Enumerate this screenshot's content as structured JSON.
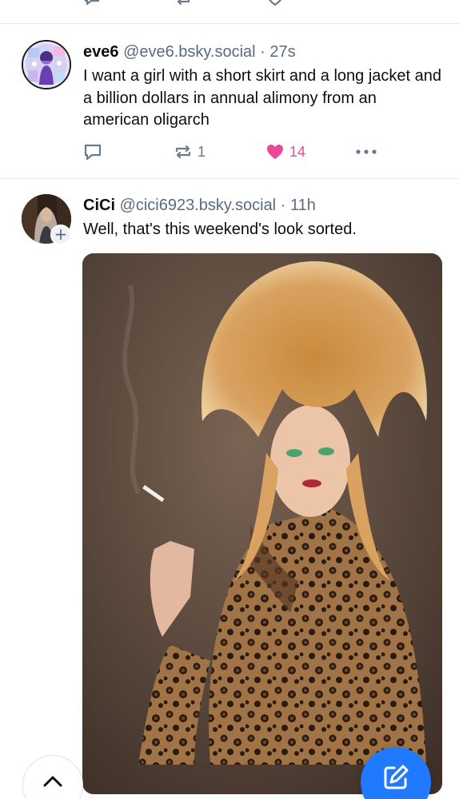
{
  "posts": [
    {
      "display_name": "eve6",
      "handle": "@eve6.bsky.social",
      "separator": "·",
      "timestamp": "27s",
      "text": "I want a girl with a short skirt and a long jacket and a billion dollars in annual alimony from an american oligarch",
      "reposts": "1",
      "likes": "14",
      "liked": true
    },
    {
      "display_name": "CiCi",
      "handle": "@cici6923.bsky.social",
      "separator": "·",
      "timestamp": "11h",
      "text": "Well, that's this weekend's look sorted."
    }
  ],
  "colors": {
    "accent": "#1f7aff",
    "like": "#ec4899",
    "muted": "#5b6b7f"
  },
  "icons": [
    "reply-icon",
    "repost-icon",
    "heart-icon",
    "more-icon",
    "plus-icon",
    "chevron-up-icon",
    "compose-icon"
  ]
}
